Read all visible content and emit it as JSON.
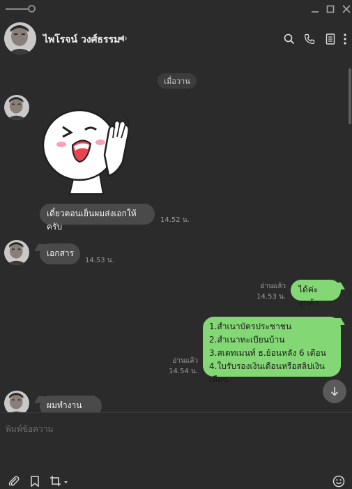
{
  "window": {
    "controls": [
      "pin-icon",
      "minimize-icon",
      "maximize-icon",
      "close-icon"
    ]
  },
  "header": {
    "contact_name": "ไพโรจน์ วงศ์ธรรม",
    "icons": [
      "speaker-icon",
      "search-icon",
      "phone-icon",
      "notes-icon",
      "more-icon"
    ]
  },
  "chat": {
    "date_separator": "เมื่อวาน",
    "messages": [
      {
        "side": "in",
        "type": "sticker",
        "sticker": "waving-face-sticker"
      },
      {
        "side": "in",
        "type": "text",
        "text": "เดี๋ยวตอนเย็นผมส่งเอกให้ครับ",
        "time": "14.52 น."
      },
      {
        "side": "in",
        "type": "text",
        "text": "เอกสาร",
        "time": "14.53 น."
      },
      {
        "side": "out",
        "type": "text",
        "text": "ได้ค่ะลูกค้า",
        "read": "อ่านแล้ว",
        "time": "14.53 น."
      },
      {
        "side": "out",
        "type": "text",
        "lines": [
          "1.สำเนาบัตรประชาชน",
          "2.สำเนาทะเบียนบ้าน",
          "3.สเตทเมนท์ ธ.ย้อนหลัง 6 เดือน",
          "4.ใบรับรองเงินเดือนหรือสลิปเงินเดือน"
        ],
        "read": "อ่านแล้ว",
        "time": "14.54 น."
      },
      {
        "side": "in",
        "type": "text",
        "text": "ผมทำงานครับ"
      }
    ]
  },
  "composer": {
    "placeholder": "พิมพ์ข้อความ",
    "tools": [
      "paperclip-icon",
      "bookmark-icon",
      "crop-icon",
      "emoji-icon"
    ]
  },
  "colors": {
    "background": "#2b2b2b",
    "incoming_bubble": "#4a4a4a",
    "outgoing_bubble": "#84d775"
  }
}
